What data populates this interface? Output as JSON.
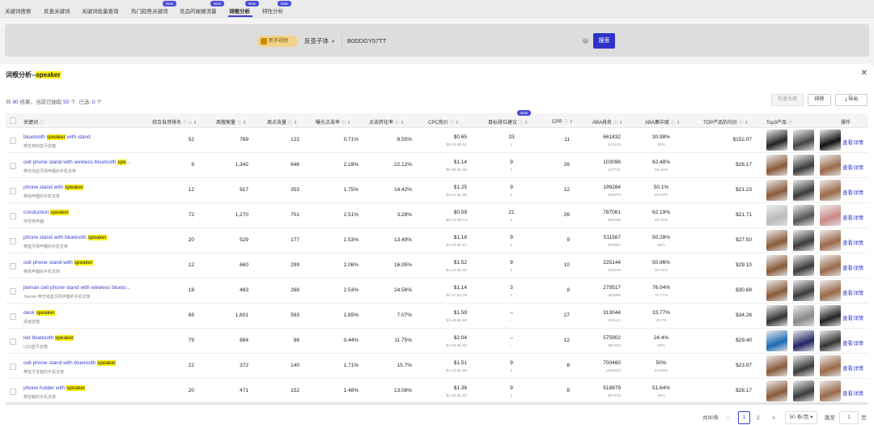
{
  "nav": {
    "tabs": [
      {
        "label": "关键词搜索"
      },
      {
        "label": "反查关键词"
      },
      {
        "label": "关键词批量查询"
      },
      {
        "label": "热门趋势关键词",
        "tag": "New"
      },
      {
        "label": "竞品的破圈流量",
        "tag": "New"
      },
      {
        "label": "词根分析",
        "tag": "New",
        "active": true
      },
      {
        "label": "特性分析",
        "tag": "beta"
      }
    ]
  },
  "search": {
    "video_label": "新手视频",
    "type_value": "反查子体",
    "asin_value": "B0DDGY57TT",
    "clear_glyph": "×",
    "button_label": "搜索"
  },
  "modal": {
    "title_prefix": "词根分析--",
    "title_keyword": "speaker",
    "close_glyph": "✕",
    "count": {
      "a": "共",
      "total": "90",
      "b": "结果，当前已抽取",
      "extracted": "50",
      "c": "个",
      "d": "已选:",
      "selected": "0",
      "e": "个"
    },
    "batch_label": "批量收藏",
    "exclude_label": "排除",
    "export_label": "导出",
    "export_icon": "download-icon"
  },
  "columns": [
    {
      "label": "关键词",
      "help": "ⓘ"
    },
    {
      "label": "综合自然排名",
      "help": "ⓘ",
      "sort": "◇ ⇕"
    },
    {
      "label": "周搜索量",
      "help": "ⓘ",
      "sort": "⇕"
    },
    {
      "label": "周点击量",
      "help": "ⓘ",
      "sort": "⇕"
    },
    {
      "label": "曝光点击率",
      "help": "ⓘ",
      "sort": "⇕"
    },
    {
      "label": "点击转化率",
      "help": "ⓘ",
      "sort": "⇕"
    },
    {
      "label": "CPC竞价",
      "help": "ⓘ",
      "sort": "⇕"
    },
    {
      "label": "目标排位建议",
      "help": "ⓘ",
      "sort": "⇕",
      "tag": "New"
    },
    {
      "label": "CPR",
      "help": "ⓘ",
      "sort": "⇕"
    },
    {
      "label": "ABA排名",
      "help": "ⓘ",
      "sort": "⇕"
    },
    {
      "label": "ABA集中度",
      "help": "ⓘ",
      "sort": "⇕"
    },
    {
      "label": "TOP产品的均价",
      "help": "ⓘ",
      "sort": "⇕"
    },
    {
      "label": "Top3产品",
      "help": "ⓘ"
    },
    {
      "label": "操作"
    }
  ],
  "rows": [
    {
      "kw_a": "bluetooth ",
      "kw_hl": "speaker",
      "kw_b": " with stand",
      "zh": "带支架的蓝牙音箱",
      "rank": "52",
      "search": "769",
      "clicks": "122",
      "ctr": "0.71%",
      "cvr": "8.55%",
      "cpc": "$0.65",
      "cpc_range": "$0.48-$0.81",
      "target": "33",
      "target_sub": "1",
      "cpr": "11",
      "aba": "661832",
      "aba_sub": "613134",
      "conc": "30.98%",
      "conc_sub": "30%",
      "price": "$152.07",
      "action": "查看详情",
      "thumbs": [
        "#222",
        "#444",
        "#111"
      ]
    },
    {
      "kw_a": "cell phone stand with wireless bluetooth ",
      "kw_hl": "spe",
      "kw_b": "...",
      "zh": "带无线蓝牙扬声器的手机支架",
      "rank": "9",
      "search": "1,342",
      "clicks": "646",
      "ctr": "2.19%",
      "cvr": "22.12%",
      "cpc": "$1.14",
      "cpc_range": "$0.88-$1.36",
      "target": "9",
      "target_sub": "2",
      "cpr": "26",
      "aba": "103096",
      "aba_sub": "147721",
      "conc": "62.48%",
      "conc_sub": "66.45%",
      "price": "$26.17",
      "action": "查看详情",
      "thumbs": [
        "#8a5a3a",
        "#3a3a3a",
        "#9a6a4a"
      ]
    },
    {
      "kw_a": "phone stand with ",
      "kw_hl": "speaker",
      "kw_b": "",
      "zh": "带扬声器的手机支架",
      "rank": "12",
      "search": "917",
      "clicks": "353",
      "ctr": "1.75%",
      "cvr": "14.42%",
      "cpc": "$1.25",
      "cpc_range": "$3.31-$1.38",
      "target": "9",
      "target_sub": "2",
      "cpr": "12",
      "aba": "199284",
      "aba_sub": "336075",
      "conc": "50.1%",
      "conc_sub": "50.58%",
      "price": "$21.23",
      "action": "查看详情",
      "thumbs": [
        "#8a5a3a",
        "#3a3a3a",
        "#9a6a4a"
      ]
    },
    {
      "kw_a": "conduction ",
      "kw_hl": "speaker",
      "kw_b": "",
      "zh": "传导扬声器",
      "rank": "72",
      "search": "1,270",
      "clicks": "701",
      "ctr": "2.51%",
      "cvr": "3.28%",
      "cpc": "$0.59",
      "cpc_range": "$3.44-$3.74",
      "target": "21",
      "target_sub": "4",
      "cpr": "26",
      "aba": "787061",
      "aba_sub": "866198",
      "conc": "62.19%",
      "conc_sub": "45.45%",
      "price": "$21.71",
      "action": "查看详情",
      "thumbs": [
        "#bbb",
        "#555",
        "#c88"
      ]
    },
    {
      "kw_a": "phone stand with bluetooth ",
      "kw_hl": "speaker",
      "kw_b": "",
      "zh": "带蓝牙扬声器的手机支架",
      "rank": "20",
      "search": "529",
      "clicks": "177",
      "ctr": "1.53%",
      "cvr": "13.49%",
      "cpc": "$1.18",
      "cpc_range": "$1.00-$1.54",
      "target": "9",
      "target_sub": "2",
      "cpr": "9",
      "aba": "511567",
      "aba_sub": "876587",
      "conc": "50.28%",
      "conc_sub": "52%",
      "price": "$27.50",
      "action": "查看详情",
      "thumbs": [
        "#8a5a3a",
        "#3a3a3a",
        "#9a6a4a"
      ]
    },
    {
      "kw_a": "cell phone stand with ",
      "kw_hl": "speaker",
      "kw_b": "",
      "zh": "带扬声器的手机支架",
      "rank": "12",
      "search": "660",
      "clicks": "299",
      "ctr": "2.06%",
      "cvr": "16.05%",
      "cpc": "$1.52",
      "cpc_range": "$1.14-$1.90",
      "target": "9",
      "target_sub": "2",
      "cpr": "10",
      "aba": "225144",
      "aba_sub": "323549",
      "conc": "50.96%",
      "conc_sub": "39.06%",
      "price": "$29.10",
      "action": "查看详情",
      "thumbs": [
        "#8a5a3a",
        "#3a3a3a",
        "#9a6a4a"
      ]
    },
    {
      "kw_a": "jteman cell phone stand with wireless blueto...",
      "kw_hl": "",
      "kw_b": "",
      "zh": "Jteman 带无线蓝牙扬声器的手机支架",
      "rank": "18",
      "search": "483",
      "clicks": "268",
      "ctr": "2.53%",
      "cvr": "24.56%",
      "cpc": "$1.14",
      "cpc_range": "$0.67-$1.39",
      "target": "3",
      "target_sub": "2",
      "cpr": "8",
      "aba": "279517",
      "aba_sub": "353860",
      "conc": "76.04%",
      "conc_sub": "70.77%",
      "price": "$30.68",
      "action": "查看详情",
      "thumbs": [
        "#8a5a3a",
        "#3a3a3a",
        "#9a6a4a"
      ]
    },
    {
      "kw_a": "desk ",
      "kw_hl": "speaker",
      "kw_b": "",
      "zh": "桌面音箱",
      "rank": "89",
      "search": "1,601",
      "clicks": "593",
      "ctr": "1.65%",
      "cvr": "7.07%",
      "cpc": "$1.59",
      "cpc_range": "$1.18-$1.99",
      "target": "–",
      "target_sub": "–",
      "cpr": "27",
      "aba": "313044",
      "aba_sub": "333121",
      "conc": "33.77%",
      "conc_sub": "29.7%",
      "price": "$34.26",
      "action": "查看详情",
      "thumbs": [
        "#333",
        "#888",
        "#222"
      ]
    },
    {
      "kw_a": "led bluetooth ",
      "kw_hl": "speaker",
      "kw_b": "",
      "zh": "LED蓝牙音箱",
      "rank": "79",
      "search": "884",
      "clicks": "86",
      "ctr": "0.44%",
      "cvr": "11.75%",
      "cpc": "$2.04",
      "cpc_range": "$1.53-$2.55",
      "target": "–",
      "target_sub": "–",
      "cpr": "12",
      "aba": "575902",
      "aba_sub": "591400",
      "conc": "24.4%",
      "conc_sub": "20%",
      "price": "$29.40",
      "action": "查看详情",
      "thumbs": [
        "#1a6ab0",
        "#226",
        "#333"
      ]
    },
    {
      "kw_a": "cell phone stand with bluetooth ",
      "kw_hl": "speaker",
      "kw_b": "",
      "zh": "带蓝牙音箱的手机支架",
      "rank": "22",
      "search": "372",
      "clicks": "140",
      "ctr": "1.71%",
      "cvr": "15.7%",
      "cpc": "$1.51",
      "cpc_range": "$1.13-$1.89",
      "target": "9",
      "target_sub": "2",
      "cpr": "8",
      "aba": "700460",
      "aba_sub": "1063633",
      "conc": "50%",
      "conc_sub": "43.59%",
      "price": "$23.97",
      "action": "查看详情",
      "thumbs": [
        "#8a5a3a",
        "#3a3a3a",
        "#9a6a4a"
      ]
    },
    {
      "kw_a": "phone holder with ",
      "kw_hl": "speaker",
      "kw_b": "",
      "zh": "带音箱的手机支架",
      "rank": "20",
      "search": "471",
      "clicks": "152",
      "ctr": "1.48%",
      "cvr": "13.08%",
      "cpc": "$1.38",
      "cpc_range": "$1.00-$1.83",
      "target": "9",
      "target_sub": "2",
      "cpr": "8",
      "aba": "518879",
      "aba_sub": "907476",
      "conc": "51.64%",
      "conc_sub": "36%",
      "price": "$28.17",
      "action": "查看详情",
      "thumbs": [
        "#8a5a3a",
        "#3a3a3a",
        "#9a6a4a"
      ]
    }
  ],
  "pagination": {
    "total_label": "共90条",
    "prev": "<",
    "page1": "1",
    "page2": "2",
    "next": ">",
    "size": "50 条/页",
    "jump_label": "跳至",
    "jump_value": "1",
    "page_unit": "页"
  }
}
